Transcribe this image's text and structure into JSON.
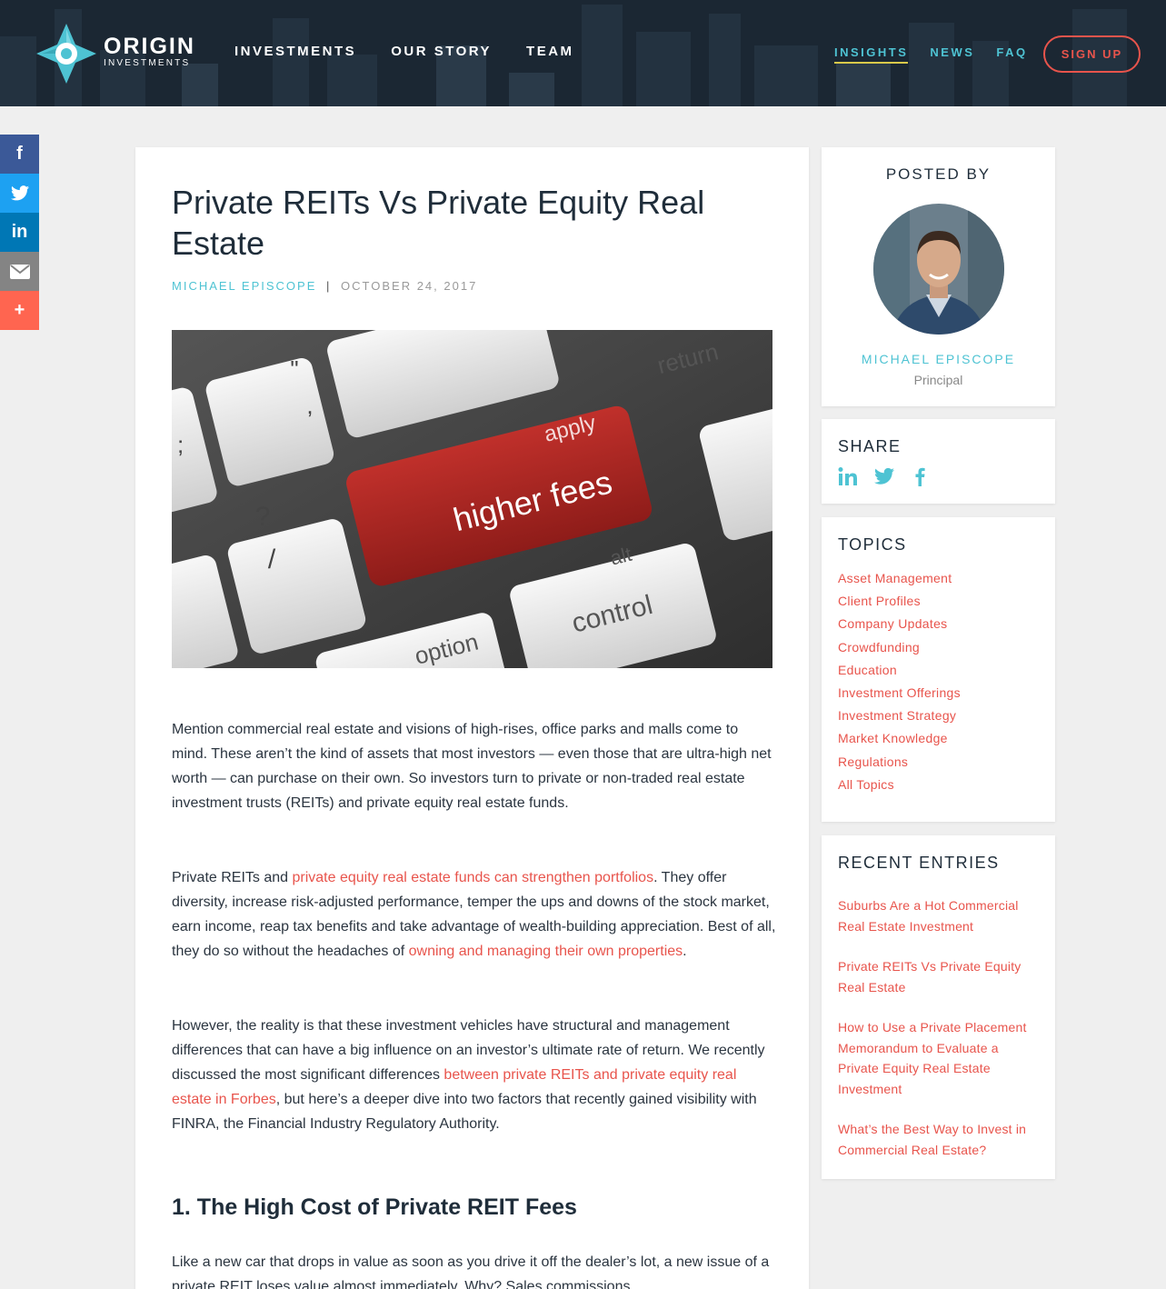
{
  "brand": {
    "name": "ORIGIN",
    "subtitle": "INVESTMENTS"
  },
  "nav": {
    "left": [
      "INVESTMENTS",
      "OUR STORY",
      "TEAM"
    ],
    "right": [
      "INSIGHTS",
      "NEWS",
      "FAQ"
    ],
    "active": "INSIGHTS",
    "signup_label": "SIGN UP"
  },
  "social_bar": [
    {
      "icon": "facebook-icon",
      "glyph": "f",
      "color": "#3b5998"
    },
    {
      "icon": "twitter-icon",
      "glyph": "",
      "color": "#1da1f2"
    },
    {
      "icon": "linkedin-icon",
      "glyph": "in",
      "color": "#0077b5"
    },
    {
      "icon": "email-icon",
      "glyph": "",
      "color": "#848484"
    },
    {
      "icon": "plus-icon",
      "glyph": "+",
      "color": "#ff6550"
    }
  ],
  "article": {
    "title": "Private REITs Vs Private Equity Real Estate",
    "author": "MICHAEL EPISCOPE",
    "separator": "|",
    "date": "OCTOBER 24, 2017",
    "hero_keys": {
      "return": "return",
      "apply": "apply",
      "higher_fees": "higher fees",
      "alt": "alt",
      "control": "control",
      "question": "?",
      "slash": "/",
      "quote": "\"",
      "comma": ",",
      "semicolon": ";",
      "option": "option"
    },
    "p1": "Mention commercial real estate and visions of high-rises, office parks and malls come to mind. These aren’t the kind of assets that most investors — even those that are ultra-high net worth — can purchase on their own. So investors turn to private or non-traded real estate investment trusts (REITs) and private equity real estate funds.",
    "p2_a": "Private REITs and ",
    "p2_link1": "private equity real estate funds can strengthen portfolios",
    "p2_b": ". They offer diversity, increase risk-adjusted performance, temper the ups and downs of the stock market, earn income, reap tax benefits and take advantage of wealth-building appreciation. Best of all, they do so without the headaches of ",
    "p2_link2": "owning and managing their own properties",
    "p2_c": ".",
    "p3_a": "However, the reality is that these investment vehicles have structural and management differences that can have a big influence on an investor’s ultimate rate of return. We recently discussed the most significant differences ",
    "p3_link": "between private REITs and private equity real estate in Forbes",
    "p3_b": ", but here’s a deeper dive into two factors that recently gained visibility with FINRA, the Financial Industry Regulatory Authority.",
    "h2": "1. The High Cost of Private REIT Fees",
    "p4": "Like a new car that drops in value as soon as you drive it off the dealer’s lot, a new issue of a private REIT loses value almost immediately. Why? Sales commissions"
  },
  "sidebar": {
    "posted_by": "POSTED BY",
    "author_name": "MICHAEL EPISCOPE",
    "author_role": "Principal",
    "share_heading": "SHARE",
    "share_icons": [
      "linkedin-icon",
      "twitter-icon",
      "facebook-icon"
    ],
    "topics_heading": "TOPICS",
    "topics": [
      "Asset Management",
      "Client Profiles",
      "Company Updates",
      "Crowdfunding",
      "Education",
      "Investment Offerings",
      "Investment Strategy",
      "Market Knowledge",
      "Regulations",
      "All Topics"
    ],
    "recent_heading": "RECENT ENTRIES",
    "recent": [
      "Suburbs Are a Hot Commercial Real Estate Investment",
      "Private REITs Vs Private Equity Real Estate",
      "How to Use a Private Placement Memorandum to Evaluate a Private Equity Real Estate Investment",
      "What’s the Best Way to Invest in Commercial Real Estate?"
    ]
  },
  "colors": {
    "header_bg": "#1b2733",
    "accent_teal": "#4ec3d3",
    "accent_red": "#e8544c",
    "active_underline": "#d9c94a"
  }
}
